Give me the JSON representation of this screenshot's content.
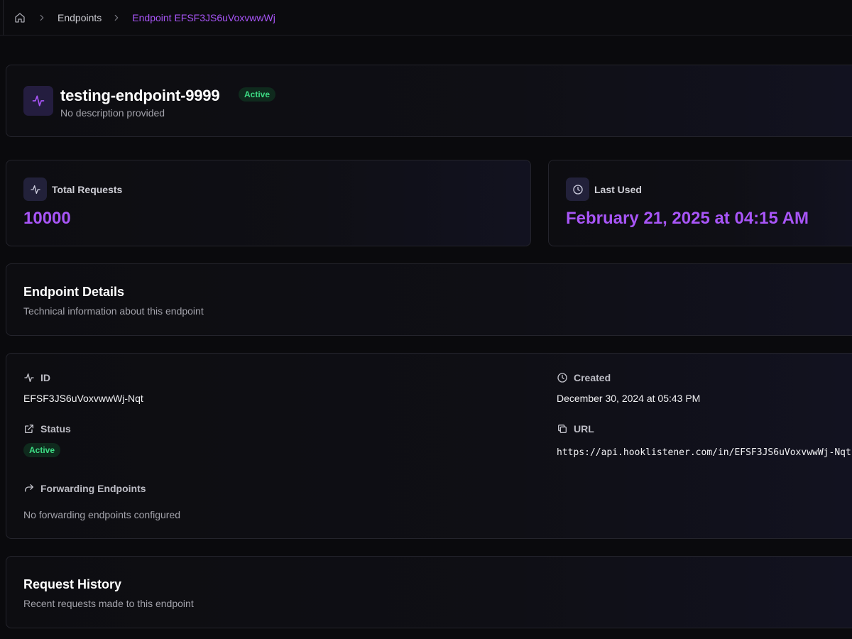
{
  "breadcrumb": {
    "items": [
      "Endpoints"
    ],
    "current": "Endpoint EFSF3JS6uVoxvwwWj"
  },
  "endpoint": {
    "name": "testing-endpoint-9999",
    "status": "Active",
    "description": "No description provided"
  },
  "stats": {
    "total_requests_label": "Total Requests",
    "total_requests_value": "10000",
    "last_used_label": "Last Used",
    "last_used_value": "February 21, 2025 at 04:15 AM"
  },
  "details_header": {
    "title": "Endpoint Details",
    "subtitle": "Technical information about this endpoint"
  },
  "details": {
    "id_label": "ID",
    "id_value": "EFSF3JS6uVoxvwwWj-Nqt",
    "created_label": "Created",
    "created_value": "December 30, 2024 at 05:43 PM",
    "status_label": "Status",
    "status_value": "Active",
    "url_label": "URL",
    "url_value": "https://api.hooklistener.com/in/EFSF3JS6uVoxvwwWj-Nqt",
    "forwarding_label": "Forwarding Endpoints",
    "forwarding_value": "No forwarding endpoints configured"
  },
  "history": {
    "title": "Request History",
    "subtitle": "Recent requests made to this endpoint"
  },
  "colors": {
    "accent": "#a855f7",
    "success": "#3ddc84",
    "background": "#0a0a0d"
  },
  "icons": {
    "home": "home-icon",
    "chevron": "chevron-right-icon",
    "activity": "activity-icon",
    "clock": "clock-icon",
    "external": "external-link-icon",
    "copy": "copy-icon",
    "forward": "forward-arrow-icon"
  }
}
